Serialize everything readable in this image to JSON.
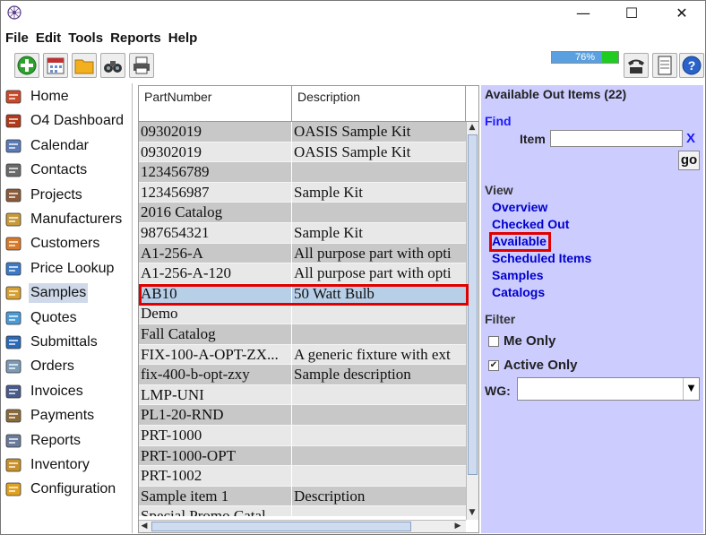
{
  "window": {
    "minimize_glyph": "—",
    "maximize_glyph": "☐",
    "close_glyph": "✕"
  },
  "menu": [
    "File",
    "Edit",
    "Tools",
    "Reports",
    "Help"
  ],
  "toolbar": {
    "progress_text": "76%",
    "progress_value": 0.76
  },
  "nav": [
    {
      "label": "Home",
      "icon": "home-icon"
    },
    {
      "label": "O4 Dashboard",
      "icon": "dashboard-icon"
    },
    {
      "label": "Calendar",
      "icon": "calendar-icon"
    },
    {
      "label": "Contacts",
      "icon": "contacts-icon"
    },
    {
      "label": "Projects",
      "icon": "projects-icon"
    },
    {
      "label": "Manufacturers",
      "icon": "manufacturers-icon"
    },
    {
      "label": "Customers",
      "icon": "customers-icon"
    },
    {
      "label": "Price Lookup",
      "icon": "price-lookup-icon"
    },
    {
      "label": "Samples",
      "icon": "samples-icon",
      "selected": true
    },
    {
      "label": "Quotes",
      "icon": "quotes-icon"
    },
    {
      "label": "Submittals",
      "icon": "submittals-icon"
    },
    {
      "label": "Orders",
      "icon": "orders-icon"
    },
    {
      "label": "Invoices",
      "icon": "invoices-icon"
    },
    {
      "label": "Payments",
      "icon": "payments-icon"
    },
    {
      "label": "Reports",
      "icon": "reports-icon"
    },
    {
      "label": "Inventory",
      "icon": "inventory-icon"
    },
    {
      "label": "Configuration",
      "icon": "configuration-icon"
    }
  ],
  "table": {
    "columns": [
      "PartNumber",
      "Description"
    ],
    "rows": [
      [
        "09302019",
        "OASIS Sample Kit"
      ],
      [
        "09302019",
        "OASIS Sample Kit"
      ],
      [
        "123456789",
        ""
      ],
      [
        "123456987",
        "Sample Kit"
      ],
      [
        "2016 Catalog",
        ""
      ],
      [
        "987654321",
        "Sample Kit"
      ],
      [
        "A1-256-A",
        "All purpose part with opti"
      ],
      [
        "A1-256-A-120",
        "All purpose part with opti"
      ],
      [
        "AB10",
        "50 Watt Bulb"
      ],
      [
        "Demo",
        ""
      ],
      [
        "Fall Catalog",
        ""
      ],
      [
        "FIX-100-A-OPT-ZX...",
        "A generic fixture with ext"
      ],
      [
        "fix-400-b-opt-zxy",
        "Sample description"
      ],
      [
        "LMP-UNI",
        ""
      ],
      [
        "PL1-20-RND",
        ""
      ],
      [
        "PRT-1000",
        ""
      ],
      [
        "PRT-1000-OPT",
        ""
      ],
      [
        "PRT-1002",
        ""
      ],
      [
        "Sample item 1",
        "Description"
      ],
      [
        "Special Promo Catal",
        ""
      ]
    ],
    "selected_row": 8
  },
  "panel": {
    "title": "Available Out Items (22)",
    "find_label": "Find",
    "item_label": "Item",
    "item_value": "",
    "clear_label": "X",
    "go_label": "go",
    "view_label": "View",
    "view_links": [
      "Overview",
      "Checked Out",
      "Available",
      "Scheduled Items",
      "Samples",
      "Catalogs"
    ],
    "filter_label": "Filter",
    "me_only_label": "Me Only",
    "me_only_checked": false,
    "active_only_label": "Active Only",
    "active_only_checked": true,
    "wg_label": "WG:",
    "wg_value": ""
  },
  "colors": {
    "panel_bg": "#ccccff",
    "link": "#0000cc",
    "highlight": "#e00000",
    "row_odd": "#c8c8c8",
    "row_even": "#e8e8e8",
    "row_selected": "#b8cfe8"
  }
}
